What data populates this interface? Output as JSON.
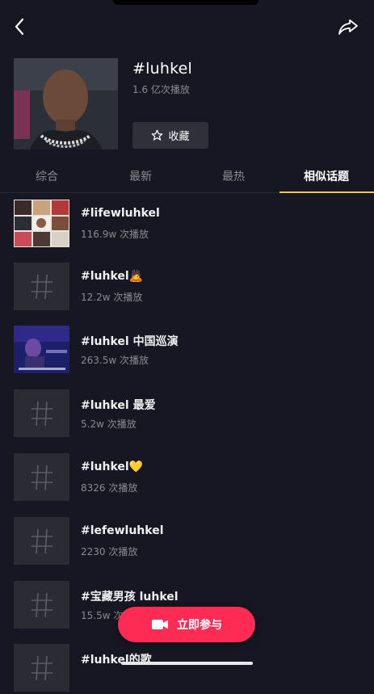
{
  "top_bar": {
    "back_icon": "chevron-left-icon",
    "share_icon": "share-arrow-icon"
  },
  "hero": {
    "title": "#luhkel",
    "plays": "1.6 亿次播放",
    "favorite_label": "收藏",
    "favorite_icon": "star-outline-icon"
  },
  "tabs": [
    {
      "label": "综合",
      "active": false
    },
    {
      "label": "最新",
      "active": false
    },
    {
      "label": "最热",
      "active": false
    },
    {
      "label": "相似话题",
      "active": true
    }
  ],
  "accent_color": "#f6c842",
  "cta_color": "#fe2c55",
  "topics": [
    {
      "title": "#lifewluhkel",
      "plays": "116.9w 次播放",
      "thumb": "image"
    },
    {
      "title": "#luhkel🙇",
      "plays": "12.2w 次播放",
      "thumb": "hash"
    },
    {
      "title": "#luhkel 中国巡演",
      "plays": "263.5w 次播放",
      "thumb": "image"
    },
    {
      "title": "#luhkel 最爱",
      "plays": "5.2w 次播放",
      "thumb": "hash"
    },
    {
      "title": "#luhkel💛",
      "plays": "8326 次播放",
      "thumb": "hash"
    },
    {
      "title": "#lefewluhkel",
      "plays": "2230 次播放",
      "thumb": "hash"
    },
    {
      "title": "#宝藏男孩 luhkel",
      "plays": "15.5w 次播放",
      "thumb": "hash"
    },
    {
      "title": "#luhkel的歌",
      "plays": "",
      "thumb": "hash"
    }
  ],
  "cta": {
    "label": "立即参与",
    "icon": "video-camera-icon"
  }
}
